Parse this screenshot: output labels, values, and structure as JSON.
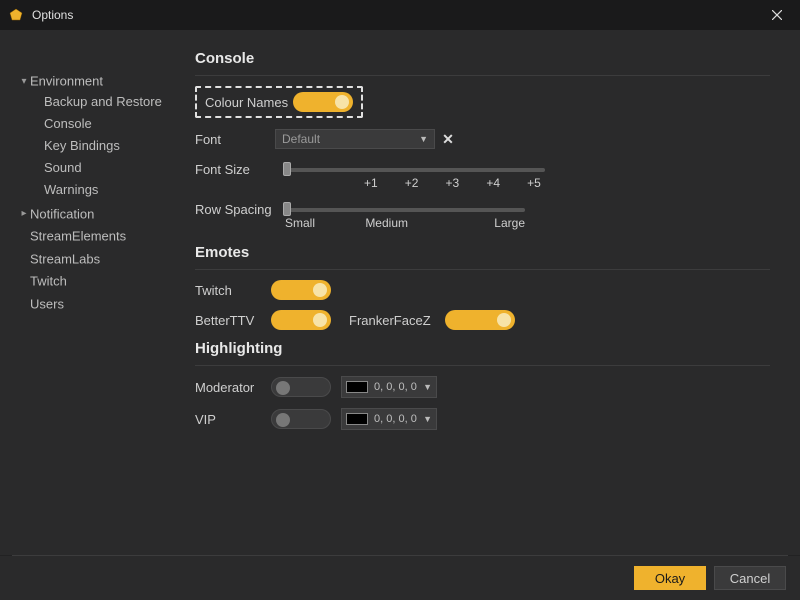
{
  "window": {
    "title": "Options"
  },
  "sidebar": {
    "items": [
      {
        "label": "Environment",
        "expanded": true,
        "children": [
          {
            "label": "Backup and Restore"
          },
          {
            "label": "Console"
          },
          {
            "label": "Key Bindings"
          },
          {
            "label": "Sound"
          },
          {
            "label": "Warnings"
          }
        ]
      },
      {
        "label": "Notification",
        "expanded": false
      },
      {
        "label": "StreamElements"
      },
      {
        "label": "StreamLabs"
      },
      {
        "label": "Twitch"
      },
      {
        "label": "Users"
      }
    ]
  },
  "sections": {
    "console": {
      "title": "Console",
      "colour_names": {
        "label": "Colour Names",
        "on": true
      },
      "font": {
        "label": "Font",
        "value": "Default"
      },
      "font_size": {
        "label": "Font Size",
        "ticks": [
          "",
          "+1",
          "+2",
          "+3",
          "+4",
          "+5"
        ],
        "value_index": 0
      },
      "row_spacing": {
        "label": "Row Spacing",
        "ticks": [
          "Small",
          "Medium",
          "Large"
        ],
        "value_index": 0
      }
    },
    "emotes": {
      "title": "Emotes",
      "twitch": {
        "label": "Twitch",
        "on": true
      },
      "betterttv": {
        "label": "BetterTTV",
        "on": true
      },
      "frankerfacez": {
        "label": "FrankerFaceZ",
        "on": true
      }
    },
    "highlighting": {
      "title": "Highlighting",
      "moderator": {
        "label": "Moderator",
        "on": false,
        "color": "0, 0, 0, 0"
      },
      "vip": {
        "label": "VIP",
        "on": false,
        "color": "0, 0, 0, 0"
      }
    }
  },
  "footer": {
    "ok": "Okay",
    "cancel": "Cancel"
  }
}
